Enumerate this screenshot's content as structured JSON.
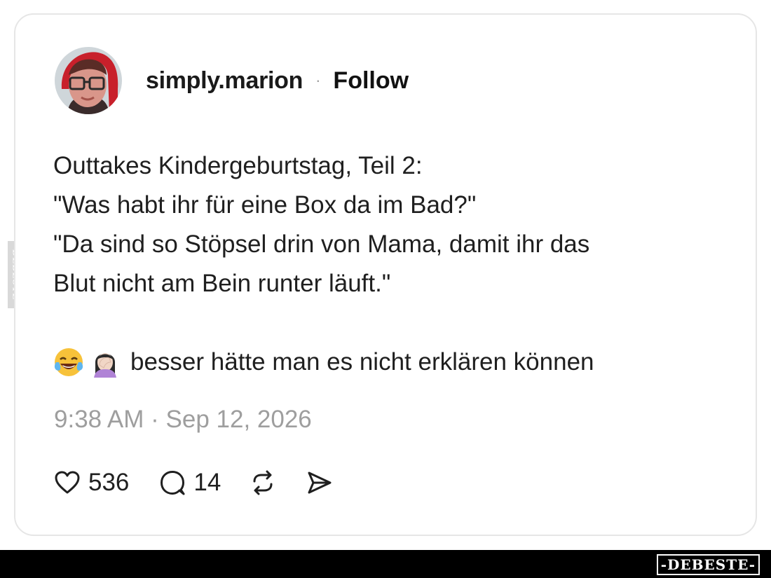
{
  "post": {
    "username": "simply.marion",
    "separator": "·",
    "follow_label": "Follow",
    "lines": [
      "Outtakes Kindergeburtstag, Teil 2:",
      "\"Was habt ihr für eine Box da im Bad?\"",
      "\"Da sind so Stöpsel drin von Mama, damit ihr das",
      "Blut nicht am Bein runter läuft.\""
    ],
    "emoji_caption": "besser hätte man es nicht erklären können",
    "emojis": [
      "face-with-tears-of-joy-icon",
      "woman-facepalming-icon"
    ],
    "timestamp": "9:38 AM · Sep 12, 2026"
  },
  "actions": {
    "likes": "536",
    "replies": "14",
    "icons": [
      "heart-icon",
      "comment-icon",
      "repost-icon",
      "share-icon"
    ]
  },
  "watermark": {
    "side_text": "DEBESTE",
    "footer_logo": "-DEBESTE-"
  },
  "colors": {
    "text": "#1f1f1f",
    "muted": "#9e9e9e",
    "card_border": "#e6e6e6",
    "footer": "#000000"
  }
}
